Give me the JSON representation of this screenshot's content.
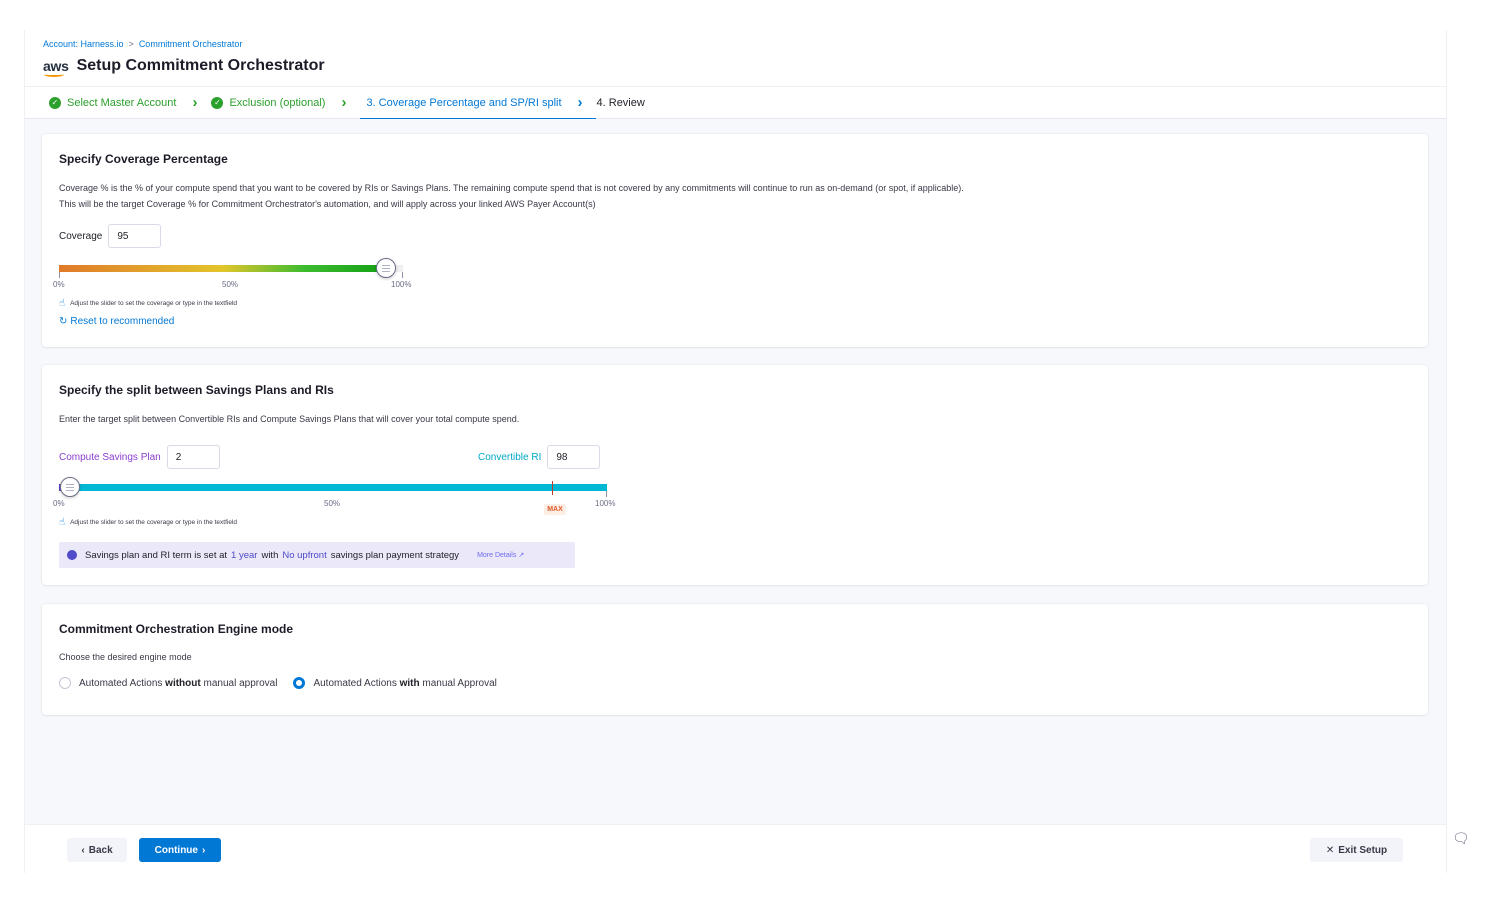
{
  "breadcrumb": {
    "account": "Account: Harness.io",
    "separator": ">",
    "current": "Commitment Orchestrator"
  },
  "header": {
    "logo_text": "aws",
    "title": "Setup Commitment Orchestrator"
  },
  "steps": [
    {
      "label": "Select Master Account",
      "status": "done"
    },
    {
      "label": "Exclusion (optional)",
      "status": "done"
    },
    {
      "label": "3. Coverage Percentage and SP/RI split",
      "status": "active"
    },
    {
      "label": "4. Review",
      "status": "todo"
    }
  ],
  "coverage": {
    "heading": "Specify Coverage Percentage",
    "desc_line1": "Coverage % is the % of your compute spend that you want to be covered by RIs or Savings Plans. The remaining compute spend that is not covered by any commitments will continue to run as on-demand (or spot, if applicable).",
    "desc_line2": "This will be the target Coverage % for Commitment Orchestrator's automation, and will apply across your linked AWS Payer Account(s)",
    "field_label": "Coverage",
    "value": "95",
    "slider_value": 95,
    "ticks": [
      "0%",
      "50%",
      "100%"
    ],
    "hint": "Adjust the slider to set the coverage or type in the textfield",
    "reset_label": "Reset to recommended"
  },
  "split": {
    "heading": "Specify the split between Savings Plans and RIs",
    "desc": "Enter the target split between Convertible RIs and Compute Savings Plans that will cover your total compute spend.",
    "sp_label": "Compute Savings Plan",
    "sp_value": "2",
    "ri_label": "Convertible RI",
    "ri_value": "98",
    "slider_value": 2,
    "max_marker_value": 90,
    "ticks": [
      "0%",
      "50%",
      "100%"
    ],
    "max_label": "MAX",
    "hint": "Adjust the slider to set the coverage or type in the textfield",
    "info": {
      "prefix": "Savings plan and RI term is set at",
      "term": "1 year",
      "with": "with",
      "strategy": "No upfront",
      "suffix": "savings plan payment strategy",
      "more": "More Details"
    }
  },
  "engine": {
    "heading": "Commitment Orchestration Engine mode",
    "desc": "Choose the desired engine mode",
    "option1_prefix": "Automated Actions",
    "option1_bold": "without",
    "option1_suffix": "manual approval",
    "option1_selected": false,
    "option2_prefix": "Automated Actions",
    "option2_bold": "with",
    "option2_suffix": "manual Approval",
    "option2_selected": true
  },
  "footer": {
    "back": "Back",
    "continue": "Continue",
    "exit": "Exit Setup"
  },
  "colors": {
    "primary": "#0278d5",
    "success": "#2ca02c",
    "cyan": "#00b8d4",
    "purple": "#8a3fcc"
  }
}
